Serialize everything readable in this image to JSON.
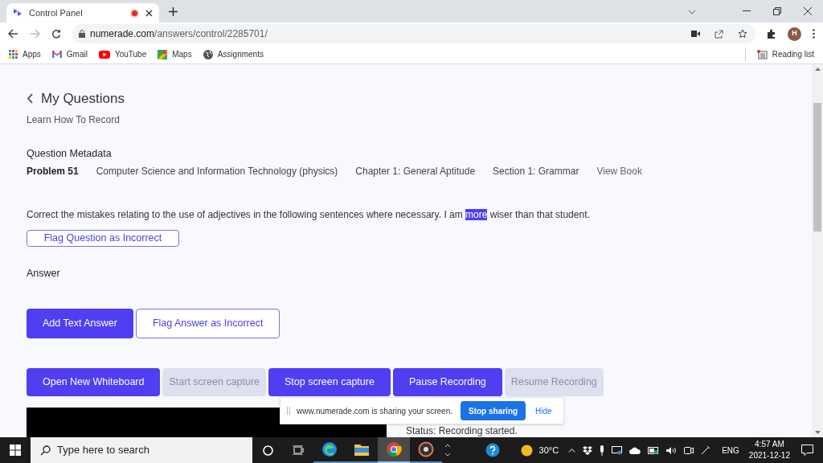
{
  "browser": {
    "tab_title": "Control Panel",
    "url_host": "numerade.com",
    "url_path": "/answers/control/2285701/",
    "avatar": "H",
    "recording": true,
    "bookmarks": [
      {
        "kind": "apps",
        "label": "Apps"
      },
      {
        "kind": "gmail",
        "label": "Gmail"
      },
      {
        "kind": "youtube",
        "label": "YouTube"
      },
      {
        "kind": "maps",
        "label": "Maps"
      },
      {
        "kind": "globe",
        "label": "Assignments"
      }
    ],
    "reading_list": "Reading list"
  },
  "page": {
    "title": "My Questions",
    "subtitle": "Learn How To Record",
    "metadata_heading": "Question Metadata",
    "metadata": [
      {
        "kind": "strong",
        "text": "Problem 51"
      },
      {
        "kind": "plain",
        "text": "Computer Science and Information Technology (physics)"
      },
      {
        "kind": "plain",
        "text": "Chapter 1: General Aptitude"
      },
      {
        "kind": "plain",
        "text": "Section 1: Grammar"
      },
      {
        "kind": "link",
        "text": "View Book"
      }
    ],
    "question": [
      {
        "text": "Correct the mistakes relating to the use of adjectives in the following sentences where necessary. I am ",
        "selected": false
      },
      {
        "text": "more",
        "selected": true
      },
      {
        "text": " wiser than that student.",
        "selected": false
      }
    ],
    "flag_question": "Flag Question as Incorrect",
    "answer_heading": "Answer",
    "answer_buttons": [
      {
        "label": "Add Text Answer",
        "kind": "primary"
      },
      {
        "label": "Flag Answer as Incorrect",
        "kind": "outline"
      }
    ],
    "record_buttons": [
      {
        "label": "Open New Whiteboard",
        "disabled": false
      },
      {
        "label": "Start screen capture",
        "disabled": true
      },
      {
        "label": "Stop screen capture",
        "disabled": false
      },
      {
        "label": "Pause Recording",
        "disabled": false
      },
      {
        "label": "Resume Recording",
        "disabled": true
      }
    ],
    "status": "Status: Recording started."
  },
  "sharing_bar": {
    "message": "www.numerade.com is sharing your screen.",
    "stop": "Stop sharing",
    "hide": "Hide"
  },
  "taskbar": {
    "search_placeholder": "Type here to search",
    "apps": [
      {
        "kind": "edge",
        "selected": false
      },
      {
        "kind": "explorer",
        "selected": false
      },
      {
        "kind": "chrome",
        "selected": true
      },
      {
        "kind": "disc",
        "selected": false
      }
    ],
    "temperature": "30°C",
    "language": "ENG",
    "time": "4:57 AM",
    "date": "2021-12-12"
  }
}
